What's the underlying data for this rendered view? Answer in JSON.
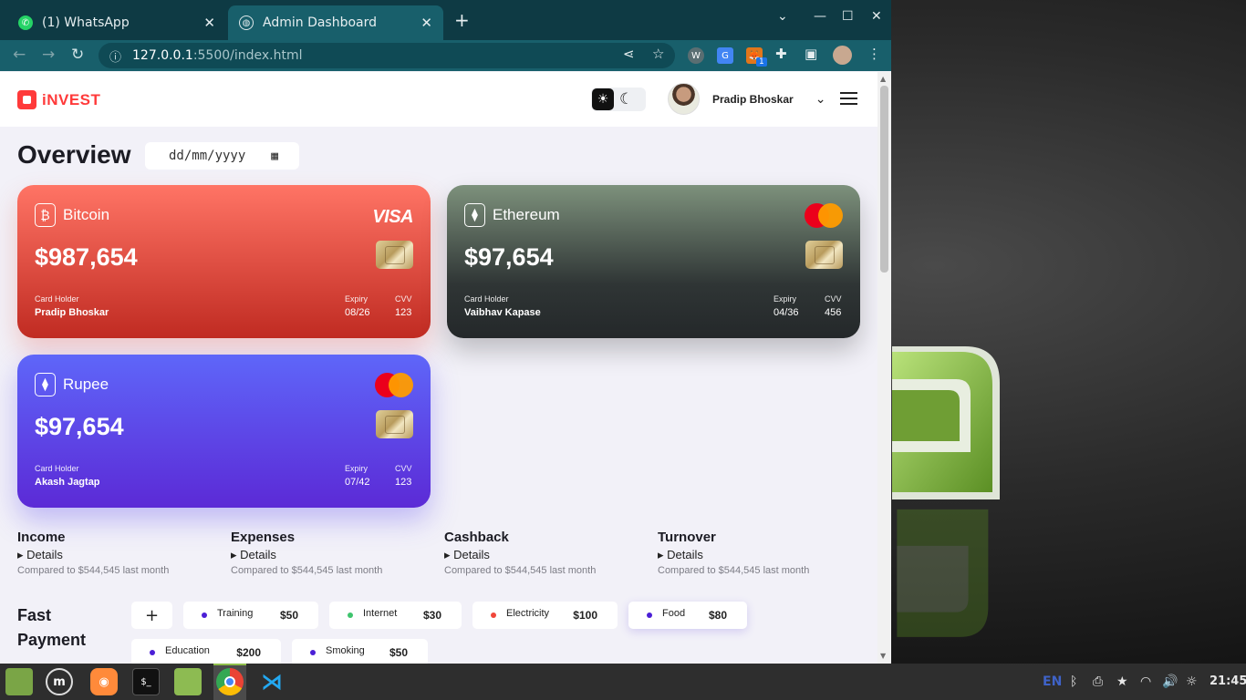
{
  "browser": {
    "tabs": [
      {
        "label": "(1) WhatsApp",
        "icon": "whatsapp-icon"
      },
      {
        "label": "Admin Dashboard",
        "icon": "globe-icon"
      }
    ],
    "url_host": "127.0.0.1",
    "url_path": ":5500/index.html",
    "extension_badge": "1"
  },
  "app": {
    "logo": "iNVEST",
    "user_name": "Pradip Bhoskar",
    "title": "Overview",
    "date_placeholder": "dd/mm/yyyy"
  },
  "cards": [
    {
      "name": "Bitcoin",
      "amount": "$987,654",
      "brand": "VISA",
      "holder_label": "Card Holder",
      "holder": "Pradip Bhoskar",
      "expiry_label": "Expiry",
      "expiry": "08/26",
      "cvv_label": "CVV",
      "cvv": "123"
    },
    {
      "name": "Ethereum",
      "amount": "$97,654",
      "brand": "mastercard",
      "holder_label": "Card Holder",
      "holder": "Vaibhav Kapase",
      "expiry_label": "Expiry",
      "expiry": "04/36",
      "cvv_label": "CVV",
      "cvv": "456"
    },
    {
      "name": "Rupee",
      "amount": "$97,654",
      "brand": "mastercard",
      "holder_label": "Card Holder",
      "holder": "Akash Jagtap",
      "expiry_label": "Expiry",
      "expiry": "07/42",
      "cvv_label": "CVV",
      "cvv": "123"
    }
  ],
  "stats": [
    {
      "title": "Income",
      "details": "Details",
      "compare": "Compared to $544,545 last month"
    },
    {
      "title": "Expenses",
      "details": "Details",
      "compare": "Compared to $544,545 last month"
    },
    {
      "title": "Cashback",
      "details": "Details",
      "compare": "Compared to $544,545 last month"
    },
    {
      "title": "Turnover",
      "details": "Details",
      "compare": "Compared to $544,545 last month"
    }
  ],
  "fast_payment": {
    "title": "Fast Payment",
    "add": "+",
    "items": [
      {
        "label": "Training",
        "value": "$50",
        "color": "#4b1fd6"
      },
      {
        "label": "Internet",
        "value": "$30",
        "color": "#3ec46d"
      },
      {
        "label": "Electricity",
        "value": "$100",
        "color": "#f0463a"
      },
      {
        "label": "Food",
        "value": "$80",
        "color": "#4b1fd6"
      },
      {
        "label": "Education",
        "value": "$200",
        "color": "#4b1fd6"
      },
      {
        "label": "Smoking",
        "value": "$50",
        "color": "#4b1fd6"
      }
    ]
  },
  "taskbar": {
    "lang": "EN",
    "time": "21:45"
  }
}
